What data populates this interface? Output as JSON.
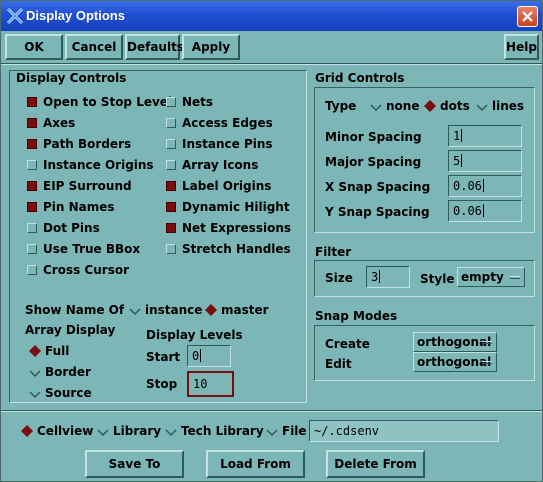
{
  "window": {
    "title": "Display Options"
  },
  "toolbar": {
    "ok": "OK",
    "cancel": "Cancel",
    "defaults": "Defaults",
    "apply": "Apply",
    "help": "Help"
  },
  "display_controls": {
    "title": "Display Controls",
    "left": [
      {
        "label": "Open to Stop Level",
        "checked": true
      },
      {
        "label": "Axes",
        "checked": true
      },
      {
        "label": "Path Borders",
        "checked": true
      },
      {
        "label": "Instance Origins",
        "checked": false
      },
      {
        "label": "EIP Surround",
        "checked": true
      },
      {
        "label": "Pin Names",
        "checked": true
      },
      {
        "label": "Dot Pins",
        "checked": false
      },
      {
        "label": "Use True BBox",
        "checked": false
      },
      {
        "label": "Cross Cursor",
        "checked": false
      }
    ],
    "right": [
      {
        "label": "Nets",
        "checked": false
      },
      {
        "label": "Access Edges",
        "checked": false
      },
      {
        "label": "Instance Pins",
        "checked": false
      },
      {
        "label": "Array Icons",
        "checked": false
      },
      {
        "label": "Label Origins",
        "checked": true
      },
      {
        "label": "Dynamic Hilight",
        "checked": true
      },
      {
        "label": "Net Expressions",
        "checked": true
      },
      {
        "label": "Stretch Handles",
        "checked": false
      }
    ],
    "show_name_of": {
      "label": "Show Name Of",
      "instance": "instance",
      "master": "master",
      "selected": "master"
    },
    "array_display": {
      "label": "Array Display",
      "full": "Full",
      "border": "Border",
      "source": "Source",
      "selected": "Full"
    },
    "display_levels": {
      "label": "Display Levels",
      "start_label": "Start",
      "start_value": "0",
      "stop_label": "Stop",
      "stop_value": "10"
    }
  },
  "grid_controls": {
    "title": "Grid Controls",
    "type_label": "Type",
    "none": "none",
    "dots": "dots",
    "lines": "lines",
    "selected": "dots",
    "minor_label": "Minor Spacing",
    "minor_value": "1",
    "major_label": "Major Spacing",
    "major_value": "5",
    "xsnap_label": "X Snap Spacing",
    "xsnap_value": "0.06",
    "ysnap_label": "Y Snap Spacing",
    "ysnap_value": "0.06"
  },
  "filter": {
    "title": "Filter",
    "size_label": "Size",
    "size_value": "3",
    "style_label": "Style",
    "style_value": "empty"
  },
  "snap_modes": {
    "title": "Snap Modes",
    "create_label": "Create",
    "create_value": "orthogonal",
    "edit_label": "Edit",
    "edit_value": "orthogonal"
  },
  "save_target": {
    "cellview": "Cellview",
    "library": "Library",
    "tech_library": "Tech Library",
    "file": "File",
    "selected": "Cellview",
    "file_value": "~/.cdsenv"
  },
  "bottom": {
    "save_to": "Save To",
    "load_from": "Load From",
    "delete_from": "Delete From"
  },
  "colors": {
    "background": "#7db6b6",
    "accent": "#7a0d0d",
    "titlebar": "#1f4fd0"
  }
}
